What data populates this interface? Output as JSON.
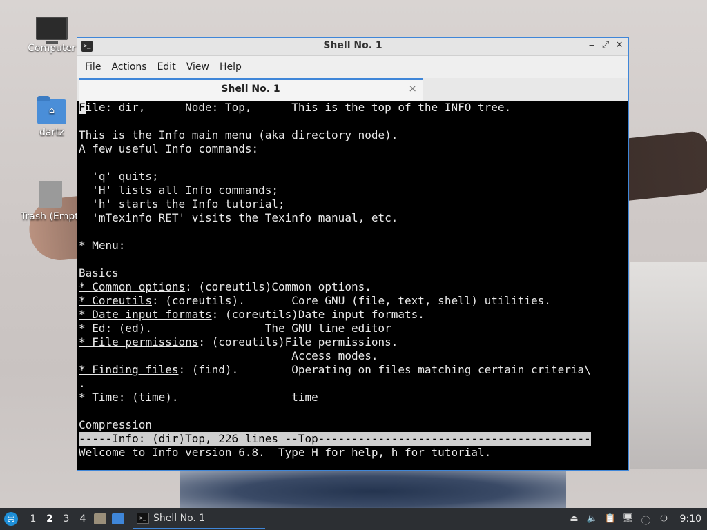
{
  "desktop": {
    "icons": [
      {
        "label": "Computer"
      },
      {
        "label": "dartz"
      },
      {
        "label": "Trash (Empty)"
      }
    ]
  },
  "window": {
    "title": "Shell No. 1",
    "menu": [
      "File",
      "Actions",
      "Edit",
      "View",
      "Help"
    ],
    "tab": {
      "label": "Shell No. 1",
      "close": "×"
    },
    "controls": {
      "minimize": "‒",
      "maximize": "⤢",
      "close": "✕"
    }
  },
  "terminal": {
    "lines": [
      "File: dir,      Node: Top,      This is the top of the INFO tree.",
      "",
      "This is the Info main menu (aka directory node).",
      "A few useful Info commands:",
      "",
      "  'q' quits;",
      "  'H' lists all Info commands;",
      "  'h' starts the Info tutorial;",
      "  'mTexinfo RET' visits the Texinfo manual, etc.",
      "",
      "* Menu:",
      "",
      "Basics",
      {
        "u": "* Common options",
        "rest": ": (coreutils)Common options."
      },
      {
        "u": "* Coreutils",
        "rest": ": (coreutils).       Core GNU (file, text, shell) utilities."
      },
      {
        "u": "* Date input formats",
        "rest": ": (coreutils)Date input formats."
      },
      {
        "u": "* Ed",
        "rest": ": (ed).                 The GNU line editor"
      },
      {
        "u": "* File permissions",
        "rest": ": (coreutils)File permissions."
      },
      "                                Access modes.",
      {
        "u": "* Finding files",
        "rest": ": (find).        Operating on files matching certain criteria\\"
      },
      ".",
      {
        "u": "* Time",
        "rest": ": (time).                 time"
      },
      "",
      "Compression"
    ],
    "status_line": "-----Info: (dir)Top, 226 lines --Top-----------------------------------------",
    "echo_line": "Welcome to Info version 6.8.  Type H for help, h for tutorial."
  },
  "taskbar": {
    "workspaces": [
      "1",
      "2",
      "3",
      "4"
    ],
    "active_workspace": "2",
    "task_label": "Shell No. 1",
    "clock": "9:10"
  }
}
